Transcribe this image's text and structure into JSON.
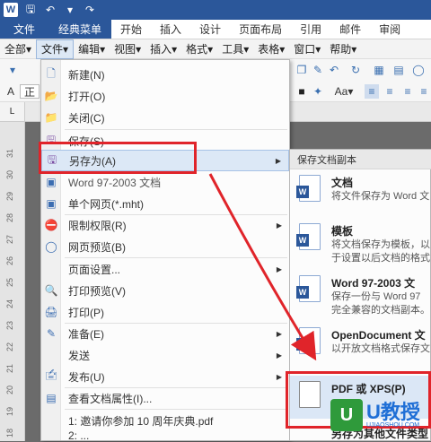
{
  "ribbon": {
    "tabs": [
      "文件",
      "经典菜单",
      "开始",
      "插入",
      "设计",
      "页面布局",
      "引用",
      "邮件",
      "审阅"
    ]
  },
  "menubar": {
    "items": [
      "全部▾",
      "文件▾",
      "编辑▾",
      "视图▾",
      "插入▾",
      "格式▾",
      "工具▾",
      "表格▾",
      "窗口▾",
      "帮助▾"
    ]
  },
  "toolbar": {
    "font_prefix": "正",
    "aa_label": "Aa▾"
  },
  "ruler": {
    "corner": "L",
    "numbers": [
      "31",
      "30",
      "29",
      "28",
      "27",
      "26",
      "25",
      "24",
      "23",
      "22",
      "21",
      "20",
      "19",
      "18"
    ]
  },
  "file_menu": {
    "items": [
      {
        "label": "新建(N)",
        "icon": "new-doc-icon",
        "arrow": false
      },
      {
        "label": "打开(O)",
        "icon": "open-folder-icon",
        "arrow": false
      },
      {
        "label": "关闭(C)",
        "icon": "close-doc-icon",
        "arrow": false
      },
      {
        "label": "保存(S)",
        "icon": "save-icon",
        "arrow": false
      },
      {
        "label": "另存为(A)",
        "icon": "save-as-icon",
        "arrow": true
      },
      {
        "label": "Word 97-2003 文档",
        "icon": "word-doc-icon",
        "arrow": false
      },
      {
        "label": "单个网页(*.mht)",
        "icon": "web-page-icon",
        "arrow": false
      },
      {
        "label": "限制权限(R)",
        "icon": "permission-icon",
        "arrow": true
      },
      {
        "label": "网页预览(B)",
        "icon": "web-preview-icon",
        "arrow": false
      },
      {
        "label": "页面设置...",
        "icon": "",
        "arrow": true
      },
      {
        "label": "打印预览(V)",
        "icon": "print-preview-icon",
        "arrow": false
      },
      {
        "label": "打印(P)",
        "icon": "print-icon",
        "arrow": false
      },
      {
        "label": "准备(E)",
        "icon": "prepare-icon",
        "arrow": true
      },
      {
        "label": "发送",
        "icon": "",
        "arrow": true
      },
      {
        "label": "发布(U)",
        "icon": "publish-icon",
        "arrow": true
      },
      {
        "label": "查看文档属性(I)...",
        "icon": "properties-icon",
        "arrow": false
      },
      {
        "label": "1: 邀请你参加 10 周年庆典.pdf",
        "icon": "",
        "arrow": false
      },
      {
        "label": "2: ...",
        "icon": "",
        "arrow": false
      }
    ]
  },
  "submenu": {
    "header": "保存文档副本",
    "items": [
      {
        "title": "文档",
        "desc1": "将文件保存为 Word 文",
        "desc2": ""
      },
      {
        "title": "模板",
        "desc1": "将文档保存为模板，以",
        "desc2": "于设置以后文档的格式"
      },
      {
        "title": "Word 97-2003 文",
        "desc1": "保存一份与 Word 97",
        "desc2": "完全兼容的文档副本。"
      },
      {
        "title": "OpenDocument 文",
        "desc1": "以开放文档格式保存文",
        "desc2": ""
      },
      {
        "title": "PDF 或 XPS(P)",
        "desc1": "",
        "desc2": ""
      },
      {
        "title": "另存为其他文件类型",
        "desc1": "",
        "desc2": ""
      }
    ]
  },
  "watermark": {
    "logo": "U",
    "text": "U教授",
    "sub": "UJIAOSHOU.COM"
  },
  "colors": {
    "accent": "#2b579a",
    "highlight": "#e0242a",
    "hover": "#dce8f6"
  }
}
